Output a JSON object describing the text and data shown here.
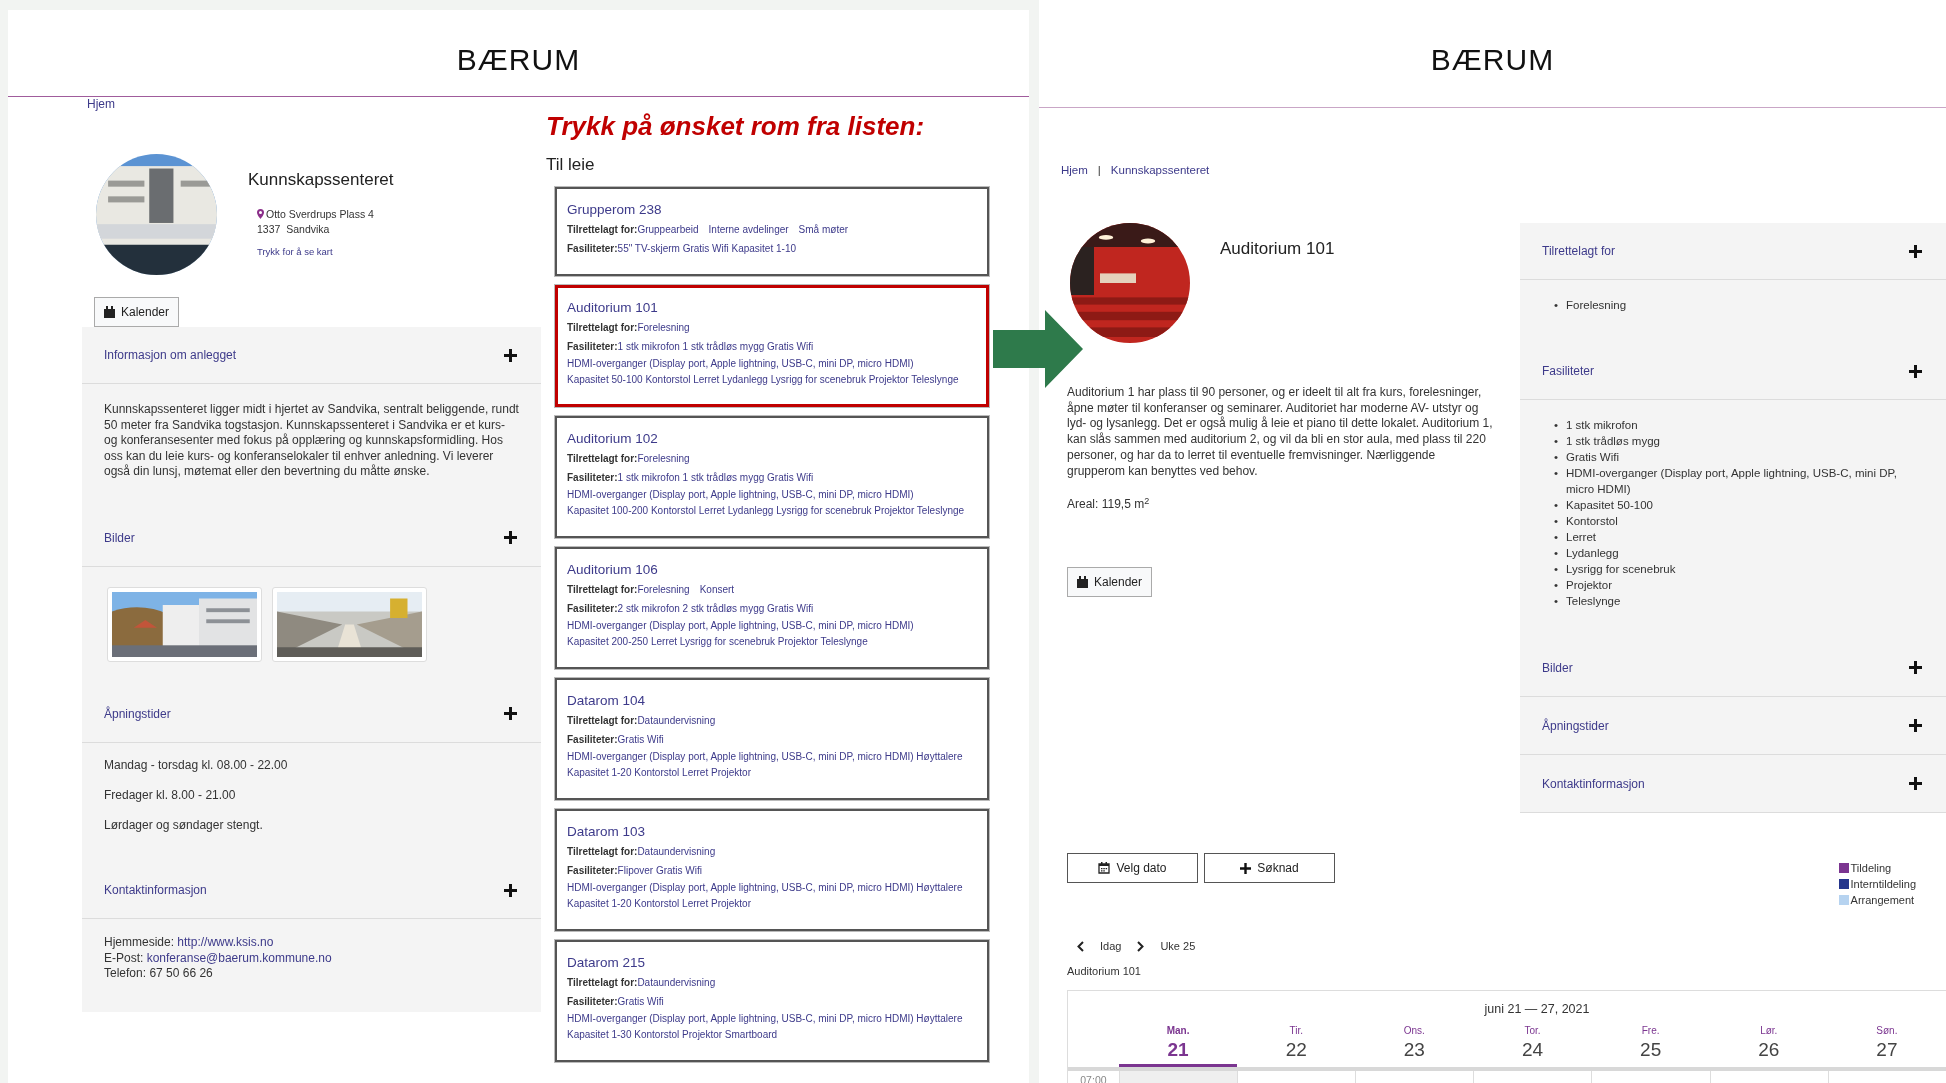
{
  "left_page": {
    "logo": "BÆRUM",
    "breadcrumb": [
      {
        "label": "Hjem"
      }
    ],
    "facility": {
      "name": "Kunnskapssenteret",
      "address_line_1": "Otto Sverdrups Plass 4",
      "address_line_2": "1337  Sandvika",
      "map_link": "Trykk for å se kart",
      "calendar_button": "Kalender"
    },
    "sections": [
      {
        "kind": "text",
        "title": "Informasjon om anlegget",
        "paragraphs": [
          "Kunnskapssenteret ligger midt i hjertet av Sandvika,  sentralt beliggende, rundt 50 meter fra Sandvika togstasjon. Kunnskapssenteret i Sandvika er et kurs- og konferansesenter med fokus på opplæring og kunnskapsformidling. Hos oss kan du leie kurs- og konferanselokaler til enhver anledning.  Vi leverer også din lunsj, møtemat eller den bevertning du måtte ønske."
        ]
      },
      {
        "kind": "images",
        "title": "Bilder"
      },
      {
        "kind": "hours",
        "title": "Åpningstider",
        "paragraphs": [
          "Mandag - torsdag kl. 08.00 - 22.00",
          "Fredager kl. 8.00 - 21.00",
          "Lørdager og søndager stengt."
        ]
      },
      {
        "kind": "contact",
        "title": "Kontaktinformasjon",
        "lines": [
          {
            "label": "Hjemmeside:",
            "value": "http://www.ksis.no",
            "kind": "link"
          },
          {
            "label": "E-Post:",
            "value": "konferanse@baerum.kommune.no",
            "kind": "link"
          },
          {
            "label": "Telefon:",
            "value": "67 50 66 26",
            "kind": "text"
          }
        ]
      }
    ],
    "instruction": "Trykk på ønsket rom fra listen:",
    "list_title": "Til leie",
    "rooms": [
      {
        "name": "Grupperom 238",
        "suited_label": "Tilrettelagt for:",
        "suited_for": [
          "Gruppearbeid",
          "Interne avdelinger",
          "Små møter"
        ],
        "facilities_label": "Fasiliteter:",
        "facility_lines": [
          "55\" TV-skjerm Gratis Wifi Kapasitet 1-10"
        ],
        "selected": false
      },
      {
        "name": "Auditorium 101",
        "suited_label": "Tilrettelagt for:",
        "suited_for": [
          "Forelesning"
        ],
        "facilities_label": "Fasiliteter:",
        "facility_lines": [
          "1 stk mikrofon 1 stk trådløs mygg Gratis Wifi",
          "HDMI-overganger (Display port, Apple lightning, USB-C, mini DP, micro HDMI)",
          "Kapasitet 50-100 Kontorstol Lerret Lydanlegg Lysrigg for scenebruk Projektor Teleslynge"
        ],
        "selected": true
      },
      {
        "name": "Auditorium 102",
        "suited_label": "Tilrettelagt for:",
        "suited_for": [
          "Forelesning"
        ],
        "facilities_label": "Fasiliteter:",
        "facility_lines": [
          "1 stk mikrofon 1 stk trådløs mygg Gratis Wifi",
          "HDMI-overganger (Display port, Apple lightning, USB-C, mini DP, micro HDMI)",
          "Kapasitet 100-200 Kontorstol Lerret Lydanlegg Lysrigg for scenebruk Projektor Teleslynge"
        ],
        "selected": false
      },
      {
        "name": "Auditorium 106",
        "suited_label": "Tilrettelagt for:",
        "suited_for": [
          "Forelesning",
          "Konsert"
        ],
        "facilities_label": "Fasiliteter:",
        "facility_lines": [
          "2 stk mikrofon 2 stk trådløs mygg Gratis Wifi",
          "HDMI-overganger (Display port, Apple lightning, USB-C, mini DP, micro HDMI)",
          "Kapasitet 200-250 Lerret Lysrigg for scenebruk Projektor Teleslynge"
        ],
        "selected": false
      },
      {
        "name": "Datarom 104",
        "suited_label": "Tilrettelagt for:",
        "suited_for": [
          "Dataundervisning"
        ],
        "facilities_label": "Fasiliteter:",
        "facility_lines": [
          "Gratis Wifi",
          "HDMI-overganger (Display port, Apple lightning, USB-C, mini DP, micro HDMI) Høyttalere",
          "Kapasitet 1-20 Kontorstol Lerret Projektor"
        ],
        "selected": false
      },
      {
        "name": "Datarom 103",
        "suited_label": "Tilrettelagt for:",
        "suited_for": [
          "Dataundervisning"
        ],
        "facilities_label": "Fasiliteter:",
        "facility_lines": [
          "Flipover Gratis Wifi",
          "HDMI-overganger (Display port, Apple lightning, USB-C, mini DP, micro HDMI) Høyttalere",
          "Kapasitet 1-20 Kontorstol Lerret Projektor"
        ],
        "selected": false
      },
      {
        "name": "Datarom 215",
        "suited_label": "Tilrettelagt for:",
        "suited_for": [
          "Dataundervisning"
        ],
        "facilities_label": "Fasiliteter:",
        "facility_lines": [
          "Gratis Wifi",
          "HDMI-overganger (Display port, Apple lightning, USB-C, mini DP, micro HDMI) Høyttalere",
          "Kapasitet 1-30 Kontorstol Projektor Smartboard"
        ],
        "selected": false
      }
    ]
  },
  "right_page": {
    "logo": "BÆRUM",
    "breadcrumb": [
      {
        "label": "Hjem"
      },
      {
        "label": "Kunnskapssenteret"
      }
    ],
    "breadcrumb_separator": "|",
    "room": {
      "name": "Auditorium 101",
      "description": "Auditorium 1 har plass til 90 personer, og er ideelt til alt fra kurs, forelesninger, åpne møter til konferanser og seminarer. Auditoriet har moderne AV- utstyr og lyd- og lysanlegg. Det er også mulig å leie et piano til dette lokalet. Auditorium 1, kan slås sammen med auditorium 2, og vil da bli en stor aula, med plass til 220 personer, og har da to lerret til eventuelle fremvisninger. Nærliggende grupperom kan benyttes ved behov.",
      "area": "Areal: 119,5 m$^{2}$",
      "calendar_button": "Kalender"
    },
    "sections": [
      {
        "title": "Tilrettelagt for",
        "bullet": "•",
        "items": [
          "Forelesning"
        ]
      },
      {
        "title": "Fasiliteter",
        "bullet": "•",
        "items": [
          "1 stk mikrofon",
          "1 stk trådløs mygg",
          "Gratis Wifi",
          "HDMI-overganger (Display port, Apple lightning, USB-C, mini DP, micro HDMI)",
          "Kapasitet 50-100",
          "Kontorstol",
          "Lerret",
          "Lydanlegg",
          "Lysrigg for scenebruk",
          "Projektor",
          "Teleslynge"
        ]
      },
      {
        "title": "Bilder"
      },
      {
        "title": "Åpningstider"
      },
      {
        "title": "Kontaktinformasjon"
      }
    ],
    "actions": [
      {
        "label": "Velg dato",
        "kind": "calendar"
      },
      {
        "label": "Søknad",
        "kind": "plus"
      }
    ],
    "legend": [
      {
        "label": "Tildeling",
        "color": "#7b3590"
      },
      {
        "label": "Interntildeling",
        "color": "#24358c"
      },
      {
        "label": "Arrangement",
        "color": "#b6d3f0"
      }
    ],
    "calendar": {
      "today_label": "Idag",
      "week": "Uke 25",
      "resource": "Auditorium 101",
      "range": "juni 21 — 27, 2021",
      "days": [
        {
          "name": "Man.",
          "date": "21",
          "selected": true
        },
        {
          "name": "Tir.",
          "date": "22",
          "selected": false
        },
        {
          "name": "Ons.",
          "date": "23",
          "selected": false
        },
        {
          "name": "Tor.",
          "date": "24",
          "selected": false
        },
        {
          "name": "Fre.",
          "date": "25",
          "selected": false
        },
        {
          "name": "Lør.",
          "date": "26",
          "selected": false
        },
        {
          "name": "Søn.",
          "date": "27",
          "selected": false
        }
      ],
      "times": [
        "07:00"
      ]
    }
  }
}
